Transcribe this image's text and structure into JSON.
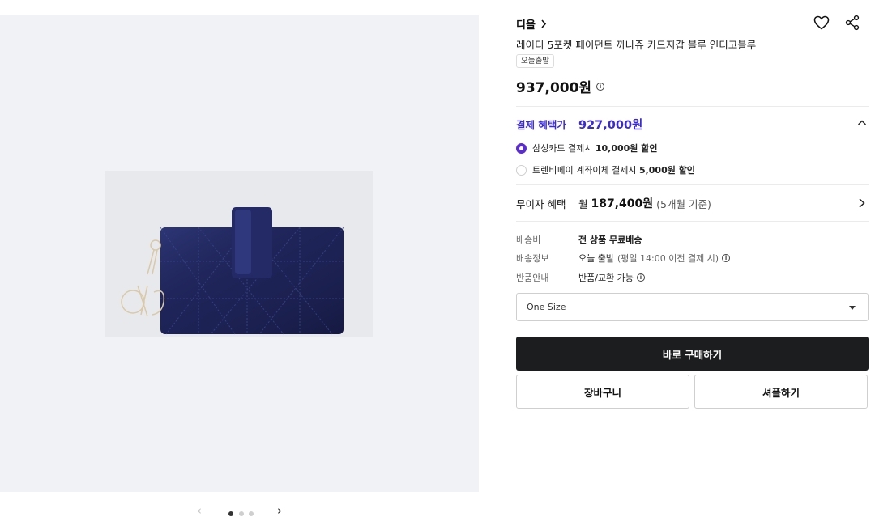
{
  "product": {
    "brand": "디올",
    "title": "레이디 5포켓 페이던트 까나쥬 카드지갑 블루 인디고블루",
    "tag": "오늘출발",
    "price": "937,000원"
  },
  "gallery": {
    "photo_icon": "card-wallet-photo",
    "pager_current": 1,
    "pager_total": 3
  },
  "benefit": {
    "label": "결제 혜택가",
    "price": "927,000원",
    "options": [
      {
        "text_prefix": "삼성카드 결제시 ",
        "text_bold": "10,000원 할인",
        "selected": true
      },
      {
        "text_prefix": "트렌비페이 계좌이체 결제시 ",
        "text_bold": "5,000원 할인",
        "selected": false
      }
    ]
  },
  "installment": {
    "label": "무이자 혜택",
    "prefix": "월",
    "amount": "187,400원",
    "note": "(5개월 기준)"
  },
  "info": {
    "shipping_fee_label": "배송비",
    "shipping_fee_value": "전 상품 무료배송",
    "shipping_info_label": "배송정보",
    "shipping_info_value": "오늘 출발",
    "shipping_info_detail": "(평일 14:00 이전 결제 시)",
    "return_label": "반품안내",
    "return_value": "반품/교환 가능"
  },
  "option_select": {
    "value": "One Size"
  },
  "actions": {
    "buy": "바로 구매하기",
    "cart": "장바구니",
    "share_buy": "셔플하기"
  },
  "colors": {
    "accent": "#3a2ad6",
    "radio": "#5a2cd2",
    "buy_bg": "#1c1d1f",
    "gallery_bg": "#f1f2f5"
  }
}
